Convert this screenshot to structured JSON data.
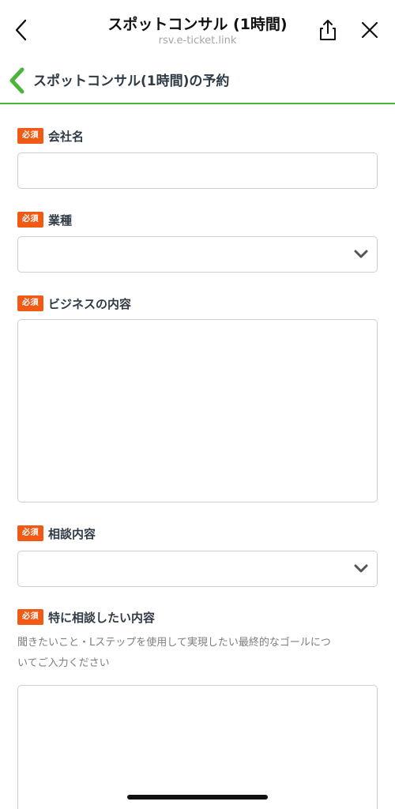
{
  "browser": {
    "title": "スポットコンサル (1時間)",
    "url": "rsv.e-ticket.link"
  },
  "page": {
    "title": "スポットコンサル(1時間)の予約"
  },
  "colors": {
    "accent": "#4cb43c",
    "required_badge": "#f05a14"
  },
  "form": {
    "required_badge": "必須",
    "fields": [
      {
        "label": "会社名",
        "type": "text",
        "value": ""
      },
      {
        "label": "業種",
        "type": "select",
        "value": ""
      },
      {
        "label": "ビジネスの内容",
        "type": "textarea",
        "value": ""
      },
      {
        "label": "相談内容",
        "type": "select",
        "value": ""
      },
      {
        "label": "特に相談したい内容",
        "type": "textarea",
        "value": "",
        "hint_line1": "聞きたいこと・Lステップを使用して実現したい最終的なゴールにつ",
        "hint_line2": "いてご入力ください"
      }
    ]
  }
}
